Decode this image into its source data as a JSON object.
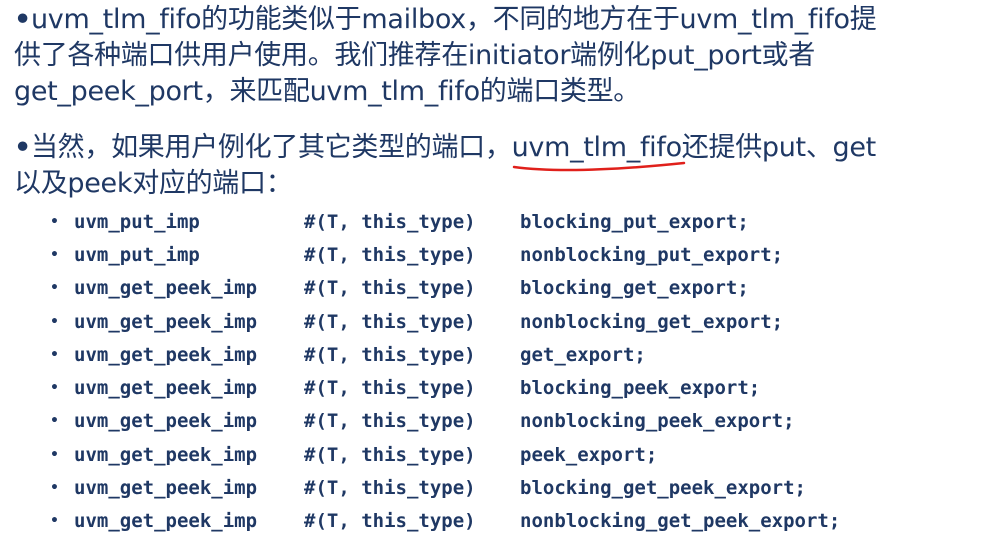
{
  "bullet_symbol": "•",
  "paragraph1": {
    "lines": [
      "uvm_tlm_fifo的功能类似于mailbox，不同的地方在于uvm_tlm_fifo提",
      "供了各种端口供用户使用。我们推荐在initiator端例化put_port或者",
      "get_peek_port，来匹配uvm_tlm_fifo的端口类型。"
    ]
  },
  "paragraph2": {
    "prefix": "当然，如果用户例化了其它类型的端口，",
    "highlight": "uvm_tlm_fifo",
    "suffix": "还提供put、get",
    "line2": "以及peek对应的端口："
  },
  "annotation_color": "#e0201b",
  "code_bullet_symbol": "•",
  "code_lines": [
    {
      "imp": "uvm_put_imp",
      "params": "#(T, this_type)",
      "export": "blocking_put_export;"
    },
    {
      "imp": "uvm_put_imp",
      "params": "#(T, this_type)",
      "export": "nonblocking_put_export;"
    },
    {
      "imp": "uvm_get_peek_imp",
      "params": "#(T, this_type)",
      "export": "blocking_get_export;"
    },
    {
      "imp": "uvm_get_peek_imp",
      "params": "#(T, this_type)",
      "export": "nonblocking_get_export;"
    },
    {
      "imp": "uvm_get_peek_imp",
      "params": "#(T, this_type)",
      "export": "get_export;"
    },
    {
      "imp": "uvm_get_peek_imp",
      "params": "#(T, this_type)",
      "export": "blocking_peek_export;"
    },
    {
      "imp": "uvm_get_peek_imp",
      "params": "#(T, this_type)",
      "export": "nonblocking_peek_export;"
    },
    {
      "imp": "uvm_get_peek_imp",
      "params": "#(T, this_type)",
      "export": "peek_export;"
    },
    {
      "imp": "uvm_get_peek_imp",
      "params": "#(T, this_type)",
      "export": "blocking_get_peek_export;"
    },
    {
      "imp": "uvm_get_peek_imp",
      "params": "#(T, this_type)",
      "export": "nonblocking_get_peek_export;"
    }
  ]
}
